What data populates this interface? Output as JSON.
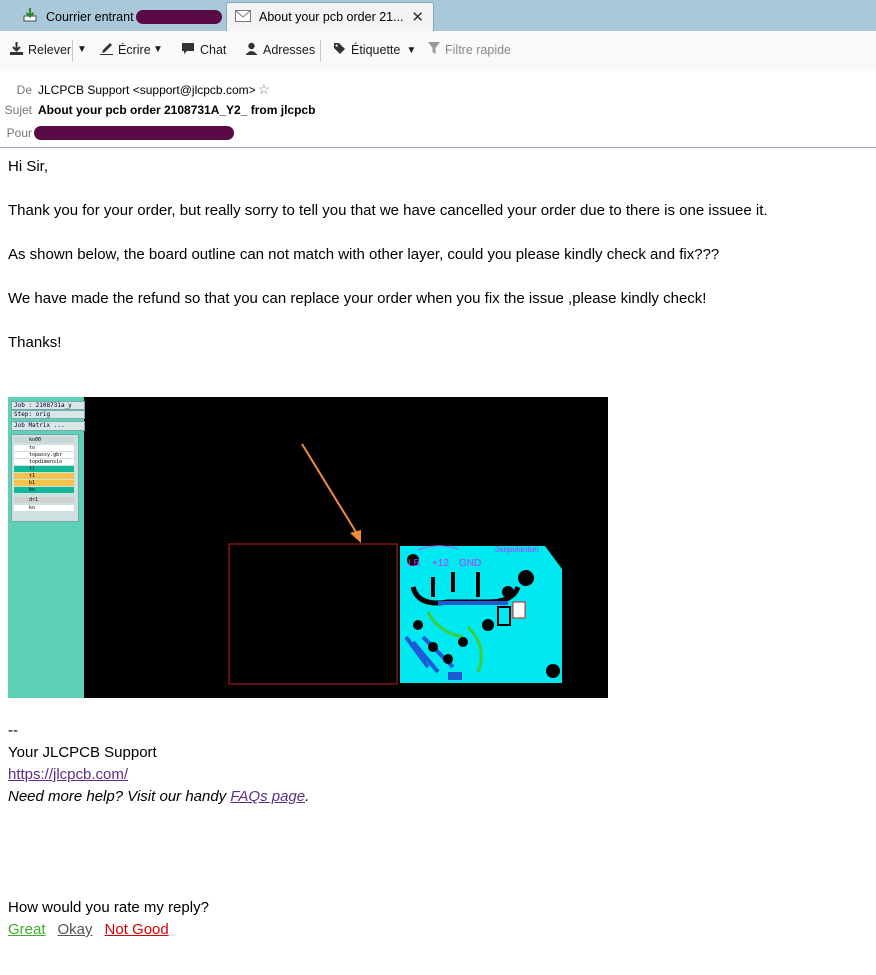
{
  "tabs": [
    {
      "label": "Courrier entrant"
    },
    {
      "label": "About your pcb  order  21..."
    }
  ],
  "toolbar": {
    "get": "Relever",
    "write": "Écrire",
    "chat": "Chat",
    "addressbook": "Adresses",
    "tag": "Étiquette",
    "quickfilter": "Filtre rapide"
  },
  "header": {
    "from_label": "De",
    "from_value": "JLCPCB Support <support@jlcpcb.com>",
    "subject_label": "Sujet",
    "subject_value": "About your pcb order 2108731A_Y2_ from jlcpcb",
    "to_label": "Pour"
  },
  "body": {
    "greeting": "Hi Sir,",
    "p1": "Thank you for your order, but really sorry to tell you that we have cancelled your order due to there is one issuee it.",
    "p2": "As shown below, the board outline can not match with other layer, could you please kindly check and fix???",
    "p3": "We have made the refund so that you can replace your order when you fix the issue ,please kindly check!",
    "thanks": "Thanks!",
    "sig_dash": "--",
    "sig_name": "Your JLCPCB Support",
    "sig_link": "https://jlcpcb.com/",
    "help_prefix": "Need more help? Visit our handy ",
    "help_link": "FAQs page",
    "help_suffix": ".",
    "rate_question": "How would you rate my reply?",
    "rate_great": "Great",
    "rate_okay": "Okay",
    "rate_bad": "Not Good"
  },
  "pcb_image": {
    "job_line": "Job : 2108731a_y",
    "step_line": "Step: orig",
    "matrix_btn": "Job Matrix ...",
    "layers": [
      "ko00",
      "to",
      "topassy.gbr",
      "topdimensio",
      "tl",
      "t1",
      "b1",
      "bo",
      "dr1",
      "ko"
    ],
    "labels": [
      "LB",
      "+12",
      "GND",
      "Janpolanton"
    ]
  },
  "colors": {
    "link": "#5b2f87",
    "great": "#3fae2a",
    "okay": "#555555",
    "bad": "#d40000",
    "tabbar": "#a9c9db",
    "redaction": "#5a0b46"
  }
}
